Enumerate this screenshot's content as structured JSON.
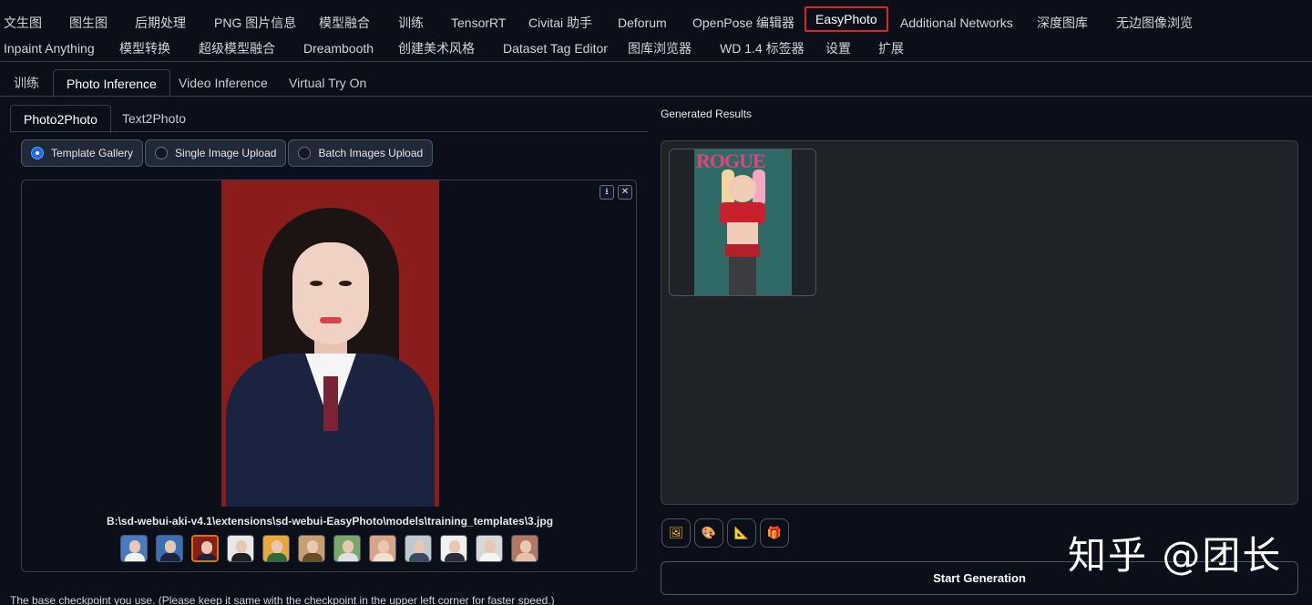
{
  "top_nav": {
    "row1": [
      "文生图",
      "图生图",
      "后期处理",
      "PNG 图片信息",
      "模型融合",
      "训练",
      "TensorRT",
      "Civitai 助手",
      "Deforum",
      "OpenPose 编辑器",
      "EasyPhoto",
      "Additional Networks",
      "深度图库",
      "无边图像浏览"
    ],
    "row2": [
      "Inpaint Anything",
      "模型转换",
      "超级模型融合",
      "Dreambooth",
      "创建美术风格",
      "Dataset Tag Editor",
      "图库浏览器",
      "WD 1.4 标签器",
      "设置",
      "扩展"
    ],
    "active": "EasyPhoto"
  },
  "sub_tabs": {
    "items": [
      "训练",
      "Photo Inference",
      "Video Inference",
      "Virtual Try On"
    ],
    "active": "Photo Inference"
  },
  "mode_tabs": {
    "items": [
      "Photo2Photo",
      "Text2Photo"
    ],
    "active": "Photo2Photo"
  },
  "upload_mode": {
    "options": [
      "Template Gallery",
      "Single Image Upload",
      "Batch Images Upload"
    ],
    "selected": "Template Gallery"
  },
  "gallery": {
    "caption": "B:\\sd-webui-aki-v4.1\\extensions\\sd-webui-EasyPhoto\\models\\training_templates\\3.jpg",
    "thumbnail_count": 12,
    "selected_index": 2,
    "download_icon": "download-icon",
    "close_icon": "close-icon"
  },
  "results": {
    "label": "Generated Results",
    "cover_title": "ROGUE"
  },
  "tools": [
    "image-icon",
    "palette-icon",
    "ruler-icon",
    "gift-icon"
  ],
  "start_button": "Start Generation",
  "help_text": "The base checkpoint you use. (Please keep it same with the checkpoint in the upper left corner for faster speed.)",
  "watermark": "知乎 @团长",
  "colors": {
    "background": "#0b0f19",
    "active_border": "#e02424",
    "selected_thumb": "#d97706",
    "radio_checked": "#2563eb"
  }
}
